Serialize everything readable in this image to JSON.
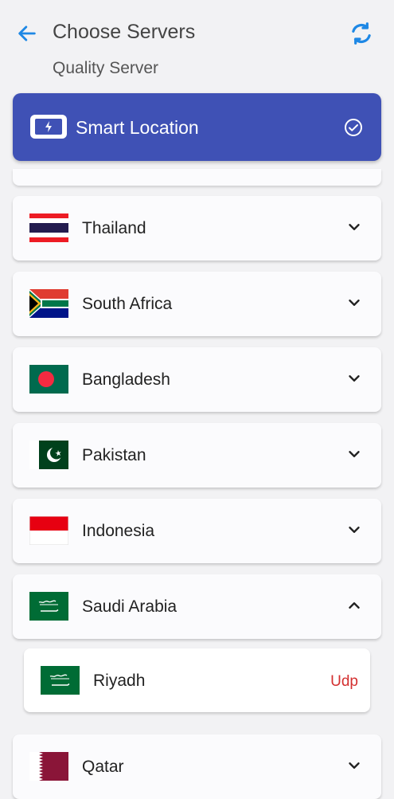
{
  "header": {
    "title": "Choose Servers",
    "subtitle": "Quality Server"
  },
  "smart": {
    "label": "Smart Location"
  },
  "countries": [
    {
      "name": "Thailand",
      "expanded": false
    },
    {
      "name": "South Africa",
      "expanded": false
    },
    {
      "name": "Bangladesh",
      "expanded": false
    },
    {
      "name": "Pakistan",
      "expanded": false
    },
    {
      "name": "Indonesia",
      "expanded": false
    },
    {
      "name": "Saudi Arabia",
      "expanded": true
    },
    {
      "name": "Qatar",
      "expanded": false
    }
  ],
  "sub_server": {
    "name": "Riyadh",
    "protocol": "Udp"
  },
  "colors": {
    "accent": "#3f51b5",
    "icon_blue": "#1e88e5",
    "protocol_red": "#d32f2f"
  }
}
